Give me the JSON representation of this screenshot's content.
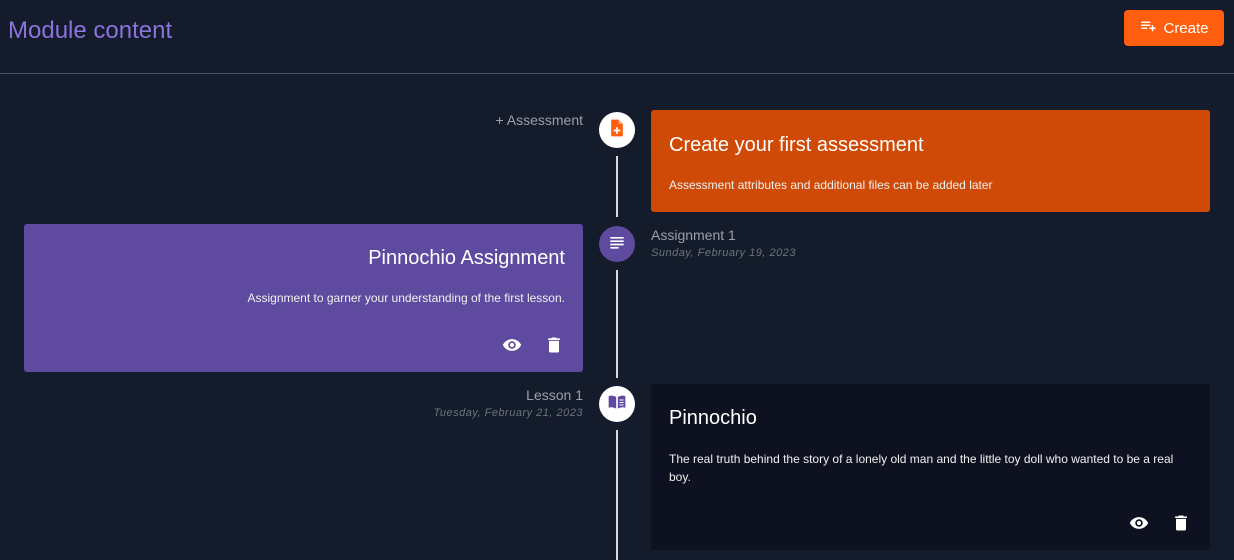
{
  "header": {
    "title": "Module content",
    "create_label": "Create"
  },
  "colors": {
    "accent": "#ff5e0e",
    "purple": "#5e4a9f",
    "assessment_card": "#cf4a06",
    "dark_card": "#0e1220",
    "background": "#141c2b"
  },
  "timeline": {
    "assessment_prompt": {
      "label": "+ Assessment",
      "title": "Create your first assessment",
      "description": "Assessment attributes and additional files can be added later",
      "icon": "file-add-icon"
    },
    "assignment": {
      "label": "Assignment 1",
      "date": "Sunday, February 19, 2023",
      "title": "Pinnochio Assignment",
      "description": "Assignment to garner your understanding of the first lesson.",
      "icon": "list-icon"
    },
    "lesson": {
      "label": "Lesson 1",
      "date": "Tuesday, February 21, 2023",
      "title": "Pinnochio",
      "description": "The real truth behind the story of a lonely old man and the little toy doll who wanted to be a real boy.",
      "icon": "book-icon"
    }
  }
}
